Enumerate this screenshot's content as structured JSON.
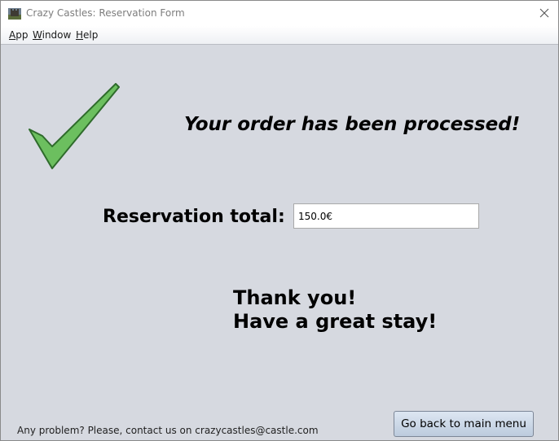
{
  "window": {
    "title": "Crazy Castles: Reservation Form",
    "close_symbol": "✕",
    "app_icon": "castle-icon"
  },
  "menubar": {
    "items": [
      {
        "mnemonic": "A",
        "rest": "pp"
      },
      {
        "mnemonic": "W",
        "rest": "indow"
      },
      {
        "mnemonic": "H",
        "rest": "elp"
      }
    ]
  },
  "content": {
    "heading": "Your order has been processed!",
    "checkmark_icon": "checkmark-icon",
    "checkmark_color": "#6cbf5f",
    "total_label": "Reservation total:",
    "total_value": "150.0€",
    "thanks_line1": "Thank you!",
    "thanks_line2": "Have a great stay!",
    "footer_text": "Any problem? Please, contact us on crazycastles@castle.com",
    "back_button_label": "Go back to main menu"
  }
}
